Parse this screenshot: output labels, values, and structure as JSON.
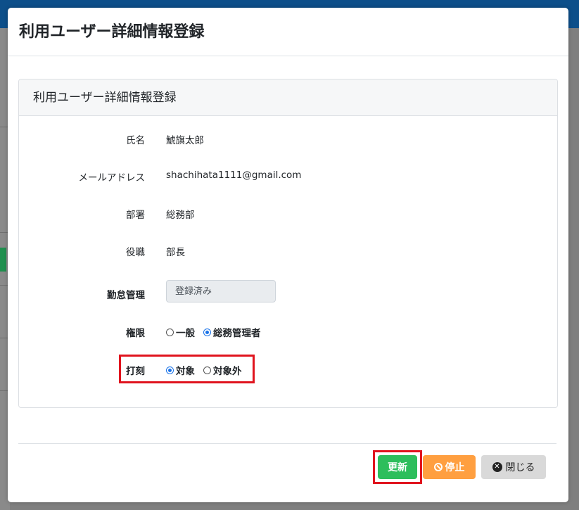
{
  "modal": {
    "title": "利用ユーザー詳細情報登録"
  },
  "card": {
    "title": "利用ユーザー詳細情報登録"
  },
  "fields": {
    "name": {
      "label": "氏名",
      "value": "鯱旗太郎"
    },
    "email": {
      "label": "メールアドレス",
      "value": "shachihata1111@gmail.com"
    },
    "department": {
      "label": "部署",
      "value": "総務部"
    },
    "position": {
      "label": "役職",
      "value": "部長"
    },
    "attendance": {
      "label": "勤怠管理",
      "value": "登録済み"
    },
    "authority": {
      "label": "権限",
      "options": [
        {
          "label": "一般",
          "checked": false
        },
        {
          "label": "総務管理者",
          "checked": true
        }
      ]
    },
    "stamp": {
      "label": "打刻",
      "options": [
        {
          "label": "対象",
          "checked": true
        },
        {
          "label": "対象外",
          "checked": false
        }
      ]
    }
  },
  "buttons": {
    "update": "更新",
    "stop": "停止",
    "close": "閉じる"
  },
  "colors": {
    "update": "#2dbe5c",
    "stop": "#ff9f40",
    "close": "#d9d9d9",
    "highlight": "#e0141e",
    "radio": "#1a73e8"
  }
}
